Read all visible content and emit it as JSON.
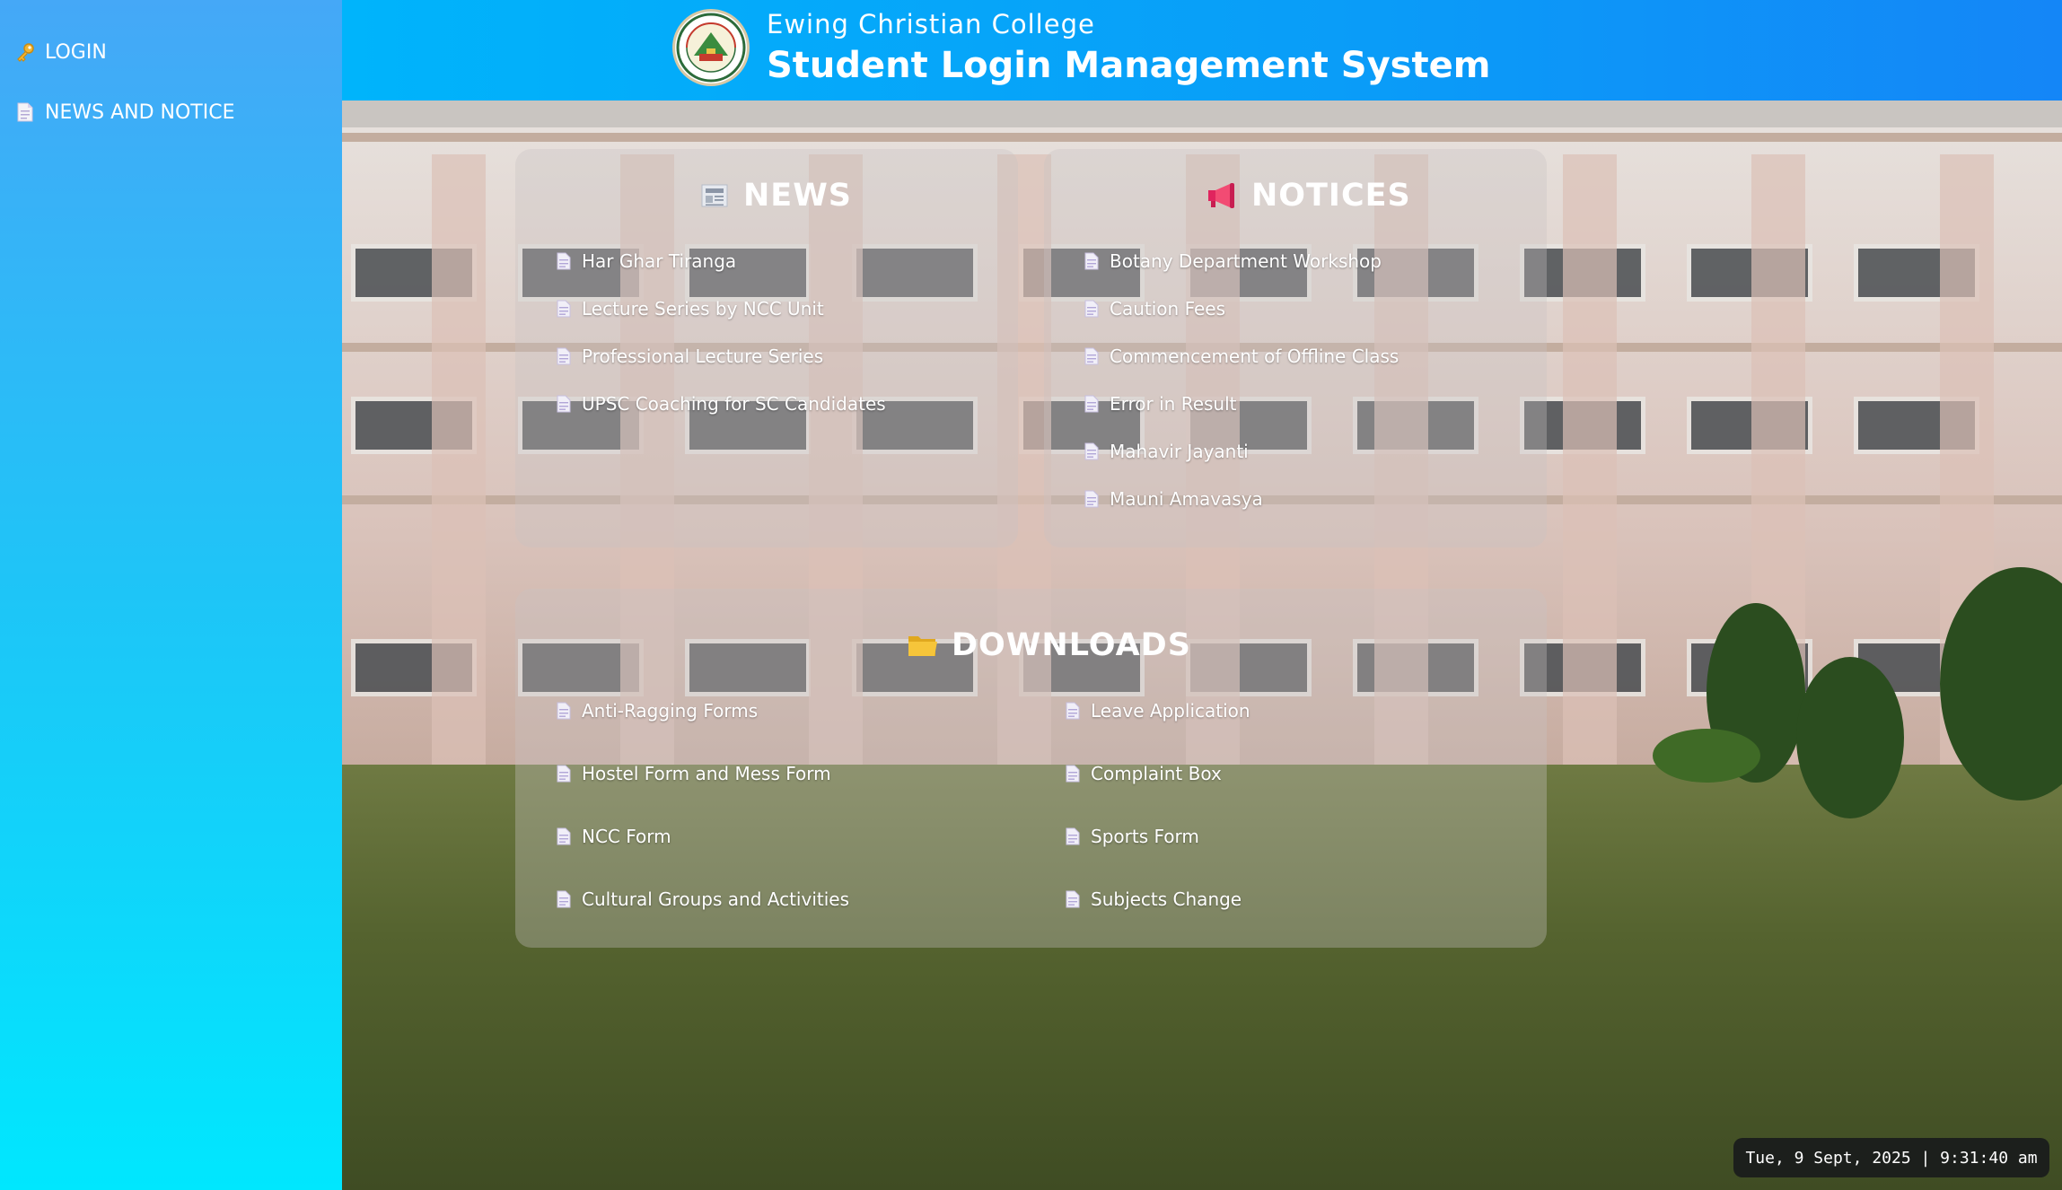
{
  "sidebar": {
    "items": [
      {
        "label": "LOGIN",
        "icon": "key-icon"
      },
      {
        "label": "NEWS AND NOTICE",
        "icon": "document-icon"
      }
    ]
  },
  "header": {
    "college_name": "Ewing Christian College",
    "system_name": "Student Login Management System",
    "logo_text": "EWING CHRISTIAN COLLEGE ALLAHABAD"
  },
  "news": {
    "title": "NEWS",
    "icon": "newspaper-icon",
    "items": [
      "Har Ghar Tiranga",
      "Lecture Series by NCC Unit",
      "Professional Lecture Series",
      "UPSC Coaching for SC Candidates"
    ]
  },
  "notices": {
    "title": "NOTICES",
    "icon": "megaphone-icon",
    "items": [
      "Botany Department Workshop",
      "Caution Fees",
      "Commencement of Offline Class",
      "Error in Result",
      "Mahavir Jayanti",
      "Mauni Amavasya"
    ]
  },
  "downloads": {
    "title": "DOWNLOADS",
    "icon": "folder-icon",
    "left": [
      "Anti-Ragging Forms",
      "Hostel Form and Mess Form",
      "NCC Form",
      "Cultural Groups and Activities"
    ],
    "right": [
      "Leave Application",
      "Complaint Box",
      "Sports Form",
      "Subjects Change"
    ]
  },
  "clock": {
    "text": "Tue, 9 Sept, 2025 | 9:31:40 am"
  },
  "colors": {
    "sidebar_top": "#45a8f7",
    "sidebar_bottom": "#00e7fe",
    "header": "#0a9cf8"
  }
}
